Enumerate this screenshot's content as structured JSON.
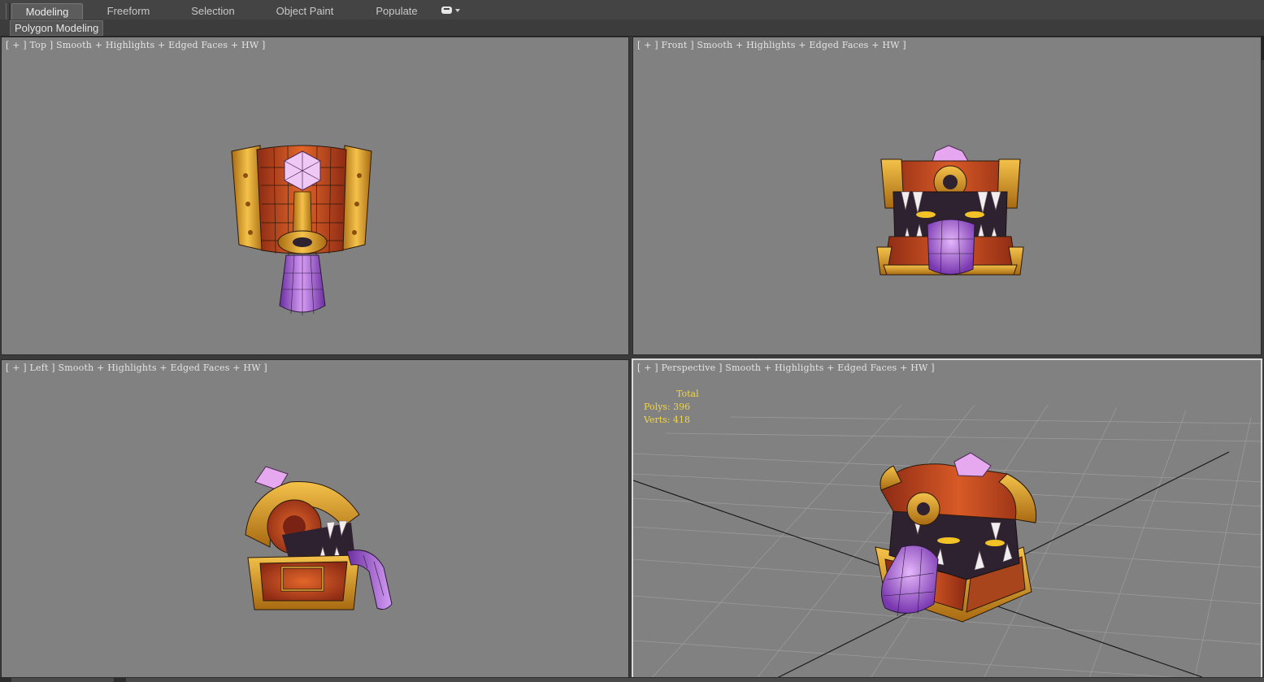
{
  "ribbon": {
    "tabs": [
      {
        "label": "Modeling",
        "active": true
      },
      {
        "label": "Freeform",
        "active": false
      },
      {
        "label": "Selection",
        "active": false
      },
      {
        "label": "Object Paint",
        "active": false
      },
      {
        "label": "Populate",
        "active": false
      }
    ],
    "panel_label": "Polygon Modeling"
  },
  "viewports": {
    "top": {
      "label": "[ + ] Top ] Smooth + Highlights + Edged Faces + HW ]"
    },
    "front": {
      "label": "[ + ] Front ] Smooth + Highlights + Edged Faces + HW ]"
    },
    "left": {
      "label": "[ + ] Left ] Smooth + Highlights + Edged Faces + HW ]"
    },
    "perspective": {
      "label": "[ + ] Perspective ] Smooth + Highlights + Edged Faces + HW ]",
      "stats": {
        "header": "Total",
        "polys": "Polys: 396",
        "verts": "Verts: 418"
      }
    }
  },
  "colors": {
    "viewport_bg": "#818181",
    "stats_text": "#f0d64a",
    "chest_red": "#b8401f",
    "chest_gold": "#e0a02a",
    "gem_pink": "#e6a9ef",
    "tongue_purple": "#a55bd8",
    "mouth_dark": "#2e2230"
  }
}
